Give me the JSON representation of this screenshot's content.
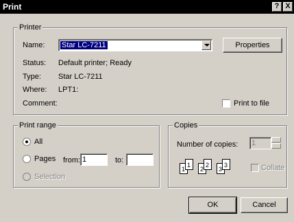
{
  "window": {
    "title": "Print",
    "help_label": "?",
    "close_label": "X"
  },
  "printer": {
    "legend": "Printer",
    "name_label": "Name:",
    "name_value": "Star LC-7211",
    "properties_label": "Properties",
    "status_label": "Status:",
    "status_value": "Default printer; Ready",
    "type_label": "Type:",
    "type_value": "Star LC-7211",
    "where_label": "Where:",
    "where_value": "LPT1:",
    "comment_label": "Comment:",
    "print_to_file_label": "Print to file"
  },
  "range": {
    "legend": "Print range",
    "all_label": "All",
    "pages_label": "Pages",
    "from_label": "from:",
    "from_value": "1",
    "to_label": "to:",
    "to_value": "",
    "selection_label": "Selection"
  },
  "copies": {
    "legend": "Copies",
    "number_label": "Number of copies:",
    "number_value": "1",
    "collate_label": "Collate",
    "page_numbers": [
      "1",
      "1",
      "2",
      "2",
      "3",
      "3"
    ]
  },
  "buttons": {
    "ok_label": "OK",
    "cancel_label": "Cancel"
  }
}
